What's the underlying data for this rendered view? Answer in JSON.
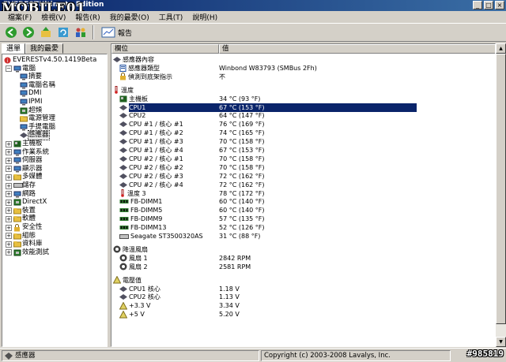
{
  "window": {
    "title": "EVERESTUltimate Edition"
  },
  "logo": {
    "text": "MOBILE01"
  },
  "menu": [
    "檔案(F)",
    "檢視(V)",
    "報告(R)",
    "我的最愛(O)",
    "工具(T)",
    "說明(H)"
  ],
  "toolbar": {
    "report_label": "報告"
  },
  "tabs": {
    "menu": "選單",
    "favorites": "我的最愛"
  },
  "tree": {
    "root": "EVERESTv4.50.1419Beta",
    "computer": "電腦",
    "computer_children": [
      "摘要",
      "電腦名稱",
      "DMI",
      "IPMI",
      "超頻",
      "電源管理",
      "手提電腦",
      "感應器"
    ],
    "categories": [
      "主機板",
      "作業系統",
      "伺服器",
      "顯示器",
      "多媒體",
      "儲存",
      "網路",
      "DirectX",
      "裝置",
      "軟體",
      "安全性",
      "組態",
      "資料庫",
      "效能測試"
    ]
  },
  "columns": {
    "field": "欄位",
    "value": "值"
  },
  "sections": {
    "sensor": {
      "title": "感應器內容",
      "rows": [
        {
          "field": "感應器類型",
          "value": "Winbond W83793  (SMBus 2Fh)"
        },
        {
          "field": "偵測到底架指示",
          "value": "不"
        }
      ]
    },
    "temperature": {
      "title": "溫度",
      "rows": [
        {
          "field": "主機板",
          "value": "34 °C  (93 °F)"
        },
        {
          "field": "CPU1",
          "value": "67 °C  (153 °F)"
        },
        {
          "field": "CPU2",
          "value": "64 °C  (147 °F)"
        },
        {
          "field": "CPU #1 / 核心 #1",
          "value": "76 °C  (169 °F)"
        },
        {
          "field": "CPU #1 / 核心 #2",
          "value": "74 °C  (165 °F)"
        },
        {
          "field": "CPU #1 / 核心 #3",
          "value": "70 °C  (158 °F)"
        },
        {
          "field": "CPU #1 / 核心 #4",
          "value": "67 °C  (153 °F)"
        },
        {
          "field": "CPU #2 / 核心 #1",
          "value": "70 °C  (158 °F)"
        },
        {
          "field": "CPU #2 / 核心 #2",
          "value": "70 °C  (158 °F)"
        },
        {
          "field": "CPU #2 / 核心 #3",
          "value": "72 °C  (162 °F)"
        },
        {
          "field": "CPU #2 / 核心 #4",
          "value": "72 °C  (162 °F)"
        },
        {
          "field": "溫度 3",
          "value": "78 °C  (172 °F)"
        },
        {
          "field": "FB-DIMM1",
          "value": "60 °C  (140 °F)"
        },
        {
          "field": "FB-DIMM5",
          "value": "60 °C  (140 °F)"
        },
        {
          "field": "FB-DIMM9",
          "value": "57 °C  (135 °F)"
        },
        {
          "field": "FB-DIMM13",
          "value": "52 °C  (126 °F)"
        },
        {
          "field": "Seagate ST3500320AS",
          "value": "31 °C  (88 °F)"
        }
      ]
    },
    "fans": {
      "title": "降溫風扇",
      "rows": [
        {
          "field": "風扇 1",
          "value": "2842 RPM"
        },
        {
          "field": "風扇 2",
          "value": "2581 RPM"
        }
      ]
    },
    "voltage": {
      "title": "電壓值",
      "rows": [
        {
          "field": "CPU1 核心",
          "value": "1.18 V"
        },
        {
          "field": "CPU2 核心",
          "value": "1.13 V"
        },
        {
          "field": "+3.3 V",
          "value": "3.34 V"
        },
        {
          "field": "+5 V",
          "value": "5.20 V"
        }
      ]
    }
  },
  "status": {
    "left": "感應器",
    "right": "Copyright (c) 2003-2008 Lavalys, Inc."
  },
  "watermark": "#985819"
}
